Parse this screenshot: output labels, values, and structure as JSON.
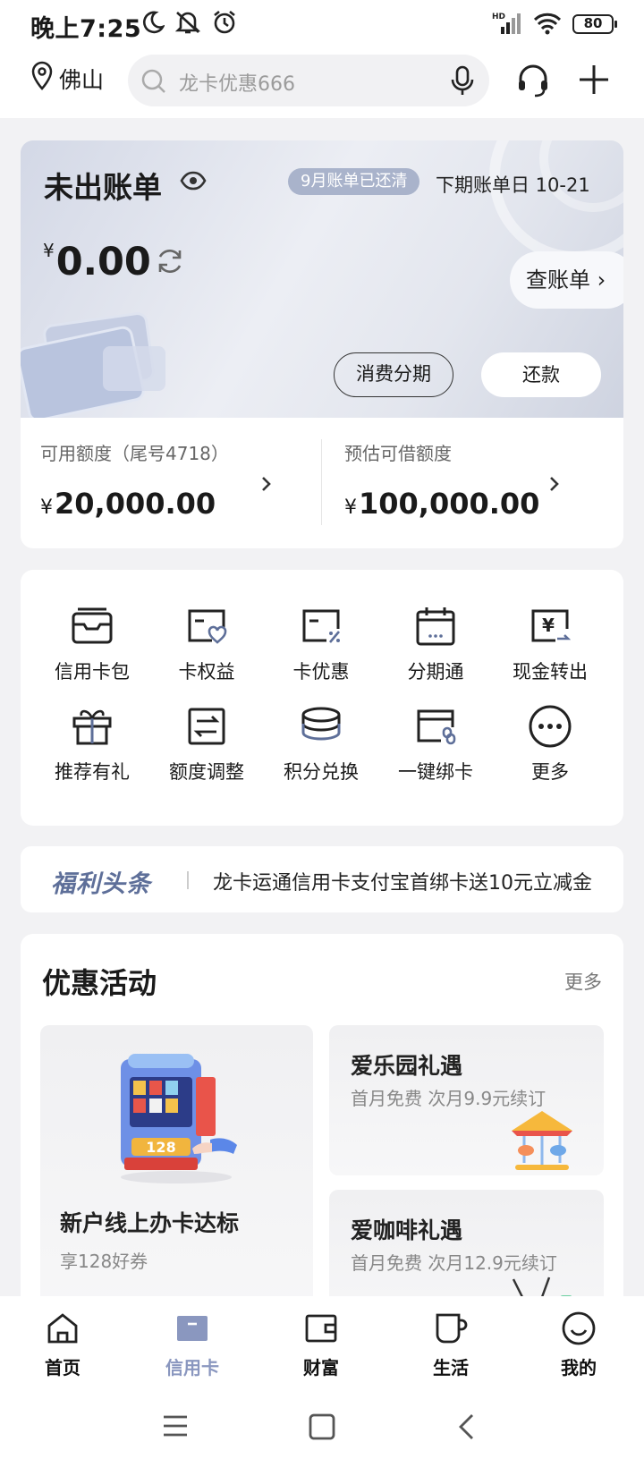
{
  "status_bar": {
    "time": "晚上7:25",
    "battery": "80",
    "icons": [
      "moon-icon",
      "mute-icon",
      "alarm-icon",
      "signal-icon",
      "wifi-icon",
      "battery-icon"
    ]
  },
  "top_bar": {
    "city": "佛山",
    "search_placeholder": "龙卡优惠666"
  },
  "bill": {
    "title": "未出账单",
    "paid_badge": "9月账单已还清",
    "next_bill": "下期账单日 10-21",
    "currency": "¥",
    "amount": "0.00",
    "view_bill": "查账单 ›",
    "installment_button": "消费分期",
    "repay_button": "还款"
  },
  "limits": {
    "available_label": "可用额度（尾号4718）",
    "available_value": "20,000.00",
    "borrow_label": "预估可借额度",
    "borrow_value": "100,000.00",
    "currency": "¥"
  },
  "grid": [
    {
      "label": "信用卡包",
      "icon": "card-wallet-icon"
    },
    {
      "label": "卡权益",
      "icon": "card-rights-icon"
    },
    {
      "label": "卡优惠",
      "icon": "card-discount-icon"
    },
    {
      "label": "分期通",
      "icon": "calendar-icon"
    },
    {
      "label": "现金转出",
      "icon": "cash-out-icon"
    },
    {
      "label": "推荐有礼",
      "icon": "gift-icon"
    },
    {
      "label": "额度调整",
      "icon": "limit-adjust-icon"
    },
    {
      "label": "积分兑换",
      "icon": "coins-icon"
    },
    {
      "label": "一键绑卡",
      "icon": "bind-card-icon"
    },
    {
      "label": "更多",
      "icon": "more-icon"
    }
  ],
  "news": {
    "tag": "福利头条",
    "text": "龙卡运通信用卡支付宝首绑卡送10元立减金"
  },
  "promotions": {
    "title": "优惠活动",
    "more": "更多",
    "main_card": {
      "title": "新户线上办卡达标",
      "subtitle": "享128好券",
      "badge": "128"
    },
    "card1": {
      "title": "爱乐园礼遇",
      "subtitle": "首月免费 次月9.9元续订"
    },
    "card2": {
      "title": "爱咖啡礼遇",
      "subtitle": "首月免费 次月12.9元续订"
    }
  },
  "tabs": [
    {
      "label": "首页",
      "icon": "home-icon"
    },
    {
      "label": "信用卡",
      "icon": "credit-card-icon"
    },
    {
      "label": "财富",
      "icon": "wallet-icon"
    },
    {
      "label": "生活",
      "icon": "cup-icon"
    },
    {
      "label": "我的",
      "icon": "smile-icon"
    }
  ],
  "colors": {
    "accent": "#8a97bf",
    "badge": "#a9b3cb",
    "news_tag": "#5e6f99"
  }
}
